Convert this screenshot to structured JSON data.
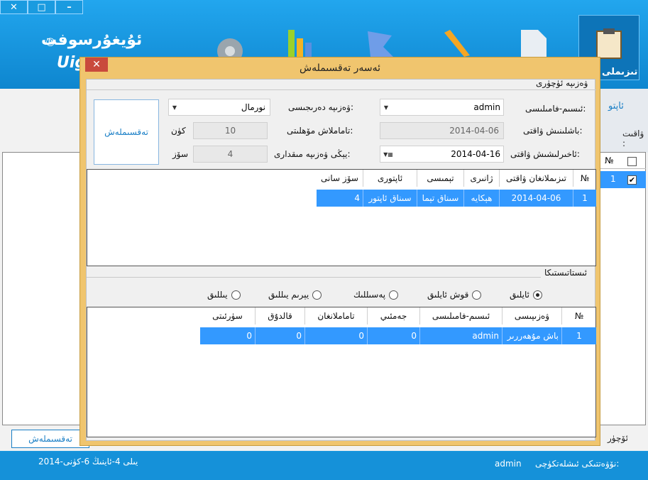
{
  "window": {
    "controls": [
      "✕",
      "□",
      "–"
    ],
    "logo_text": "ئۇيغۇرسوفت",
    "logo_reg": "®",
    "logo_latin": "Uig",
    "active_tool_label": "تىزىملى"
  },
  "main": {
    "right_label_chapters": "ئاپتو",
    "right_label_time": "ۋاقىت :",
    "list_header_no": "№",
    "list_row_no": "1",
    "bottom_button": "تەقسىملەش",
    "bottom_label": "ئۆچۈر"
  },
  "status": {
    "date": "2014-يىلى 4-ئاينىڭ 6-كۈنى",
    "user_label": "نۆۋەتتىكى ئىشلەتكۈچى:",
    "user": "admin"
  },
  "dialog": {
    "title": "ئەسەر تەقسىملەش",
    "close": "✕",
    "group_title": "ۋەزىپە ئۈچۈرى",
    "fields": {
      "name_label": "ئىسىم-فامىلىسى:",
      "name_value": "admin",
      "level_label": "ۋەزىپە دەرىجىسى:",
      "level_value": "نورمال",
      "start_label": "باشلىنىش ۋاقتى:",
      "start_value": "2014-04-06",
      "duration_label": "تاماملاش مۆھلىتى:",
      "duration_value": "10",
      "duration_unit": "كۈن",
      "end_label": "ئاخىرلىشىش ۋاقتى:",
      "end_value": "2014-04-16",
      "words_label": "يېڭى ۋەزىپە مىقدارى:",
      "words_value": "4",
      "words_unit": "سۆز"
    },
    "assign_button": "تەقسىملەش",
    "grid1": {
      "headers": [
        "№",
        "تىزىملانغان ۋاقتى",
        "ژانىرى",
        "تېمىسى",
        "ئاپتورى",
        "سۆز سانى"
      ],
      "rows": [
        [
          "1",
          "2014-04-06",
          "ھېكايە",
          "سىناق تېما",
          "سىناق ئاپتور",
          "4"
        ]
      ]
    },
    "stats_title": "ئىستاتىستىكا",
    "radios": [
      {
        "label": "ئايلىق",
        "checked": true
      },
      {
        "label": "قوش ئايلىق",
        "checked": false
      },
      {
        "label": "پەسىللىك",
        "checked": false
      },
      {
        "label": "يېرىم يىللىق",
        "checked": false
      },
      {
        "label": "يىللىق",
        "checked": false
      }
    ],
    "grid2": {
      "headers": [
        "№",
        "ۋەزىپىسى",
        "ئىسىم-فامىلىسى",
        "جەمئىي",
        "تاماملانغان",
        "قالدۇق",
        "سۈرئىتى"
      ],
      "rows": [
        [
          "1",
          "باش مۇھەررىر",
          "admin",
          "0",
          "0",
          "0",
          "0"
        ]
      ]
    }
  },
  "colors": {
    "accent_blue": "#1591d9",
    "dialog_frame": "#f0c56e",
    "selection": "#3399ff",
    "close_red": "#c94a3c"
  }
}
